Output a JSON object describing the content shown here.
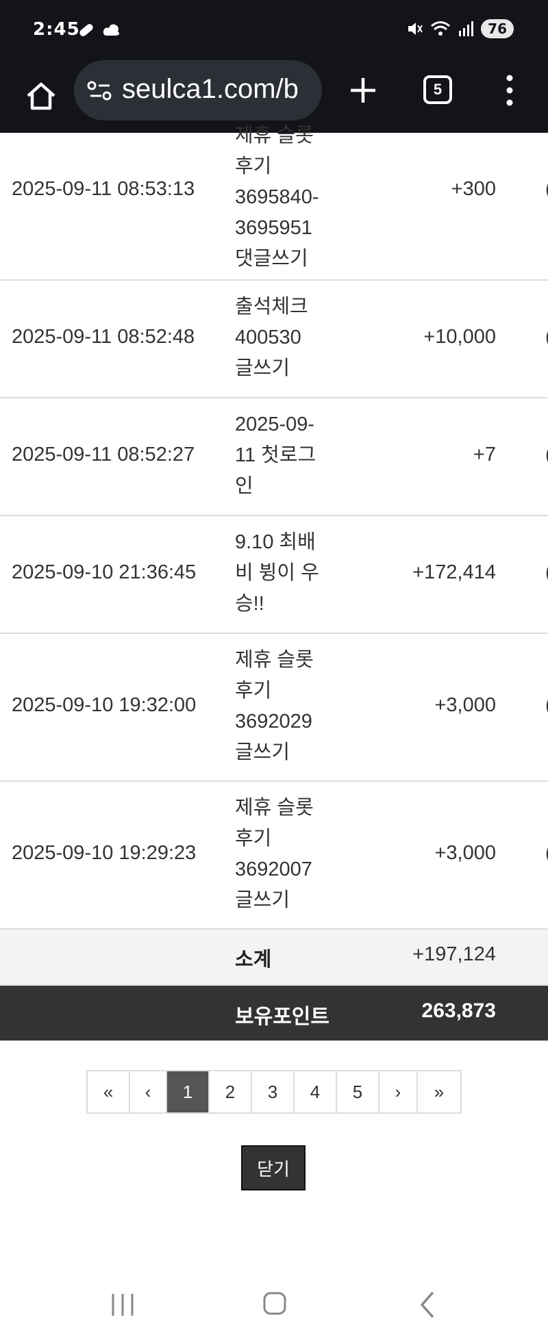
{
  "status_bar": {
    "time": "2:45",
    "battery": "76"
  },
  "browser": {
    "url": "seulca1.com/b",
    "tab_count": "5"
  },
  "rows": [
    {
      "datetime": "2025-09-11 08:53:13",
      "description": [
        "제휴 슬롯",
        "후기",
        "3695840-",
        "3695951",
        "댓글쓰기"
      ],
      "points": "+300"
    },
    {
      "datetime": "2025-09-11 08:52:48",
      "description": [
        "출석체크",
        "400530",
        "글쓰기"
      ],
      "points": "+10,000"
    },
    {
      "datetime": "2025-09-11 08:52:27",
      "description": [
        "2025-09-",
        "11 첫로그",
        "인"
      ],
      "points": "+7"
    },
    {
      "datetime": "2025-09-10 21:36:45",
      "description": [
        "9.10 최배",
        "비 뷩이 우",
        "승!!"
      ],
      "points": "+172,414"
    },
    {
      "datetime": "2025-09-10 19:32:00",
      "description": [
        "제휴 슬롯",
        "후기",
        "3692029",
        "글쓰기"
      ],
      "points": "+3,000"
    },
    {
      "datetime": "2025-09-10 19:29:23",
      "description": [
        "제휴 슬롯",
        "후기",
        "3692007",
        "글쓰기"
      ],
      "points": "+3,000"
    }
  ],
  "subtotal": {
    "label": "소계",
    "value": "+197,124"
  },
  "total": {
    "label": "보유포인트",
    "value": "263,873"
  },
  "pagination": {
    "first": "«",
    "prev": "‹",
    "pages": [
      "1",
      "2",
      "3",
      "4",
      "5"
    ],
    "current": "1",
    "next": "›",
    "last": "»"
  },
  "close_button": "닫기",
  "icons": {
    "home": "home-icon",
    "site_settings": "site-settings-icon",
    "new_tab": "plus-icon",
    "menu": "more-vert-icon",
    "recents": "recents-icon",
    "nav_home": "nav-home-icon",
    "back": "back-icon"
  }
}
